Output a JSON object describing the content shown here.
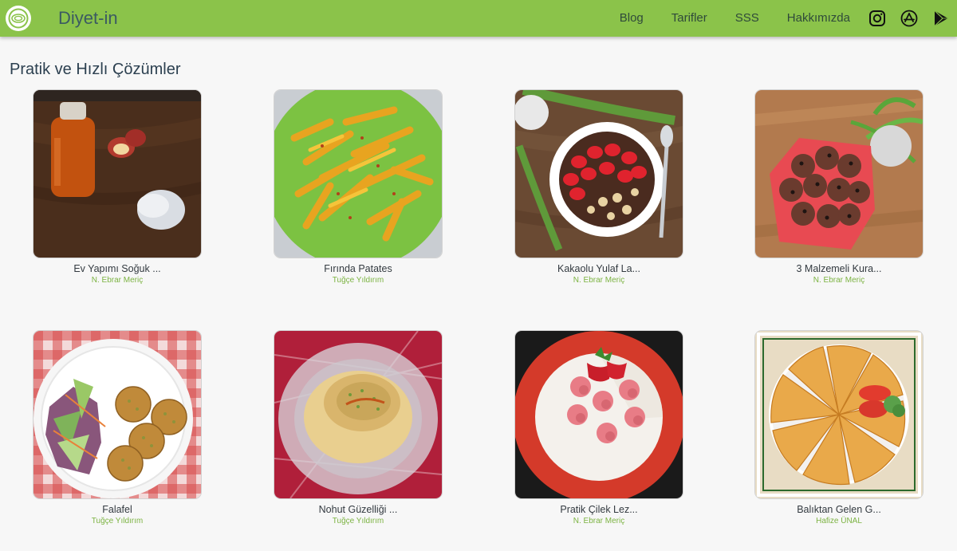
{
  "header": {
    "brand": "Diyet-in",
    "nav": [
      "Blog",
      "Tarifler",
      "SSS",
      "Hakkımızda"
    ],
    "icons": [
      "instagram-icon",
      "app-store-icon",
      "google-play-icon"
    ],
    "bar_color": "#8bc34a"
  },
  "main": {
    "title": "Pratik ve Hızlı Çözümler",
    "recipes": [
      {
        "title": "Ev Yapımı Soğuk ...",
        "author": "N. Ebrar Meriç"
      },
      {
        "title": "Fırında Patates",
        "author": "Tuğçe Yıldırım"
      },
      {
        "title": "Kakaolu Yulaf La...",
        "author": "N. Ebrar Meriç"
      },
      {
        "title": "3 Malzemeli Kura...",
        "author": "N. Ebrar Meriç"
      },
      {
        "title": "Falafel",
        "author": "Tuğçe Yıldırım"
      },
      {
        "title": "Nohut Güzelliği ...",
        "author": "Tuğçe Yıldırım"
      },
      {
        "title": "Pratik Çilek Lez...",
        "author": "N. Ebrar Meriç"
      },
      {
        "title": "Balıktan Gelen G...",
        "author": "Hafize ÜNAL"
      }
    ]
  }
}
